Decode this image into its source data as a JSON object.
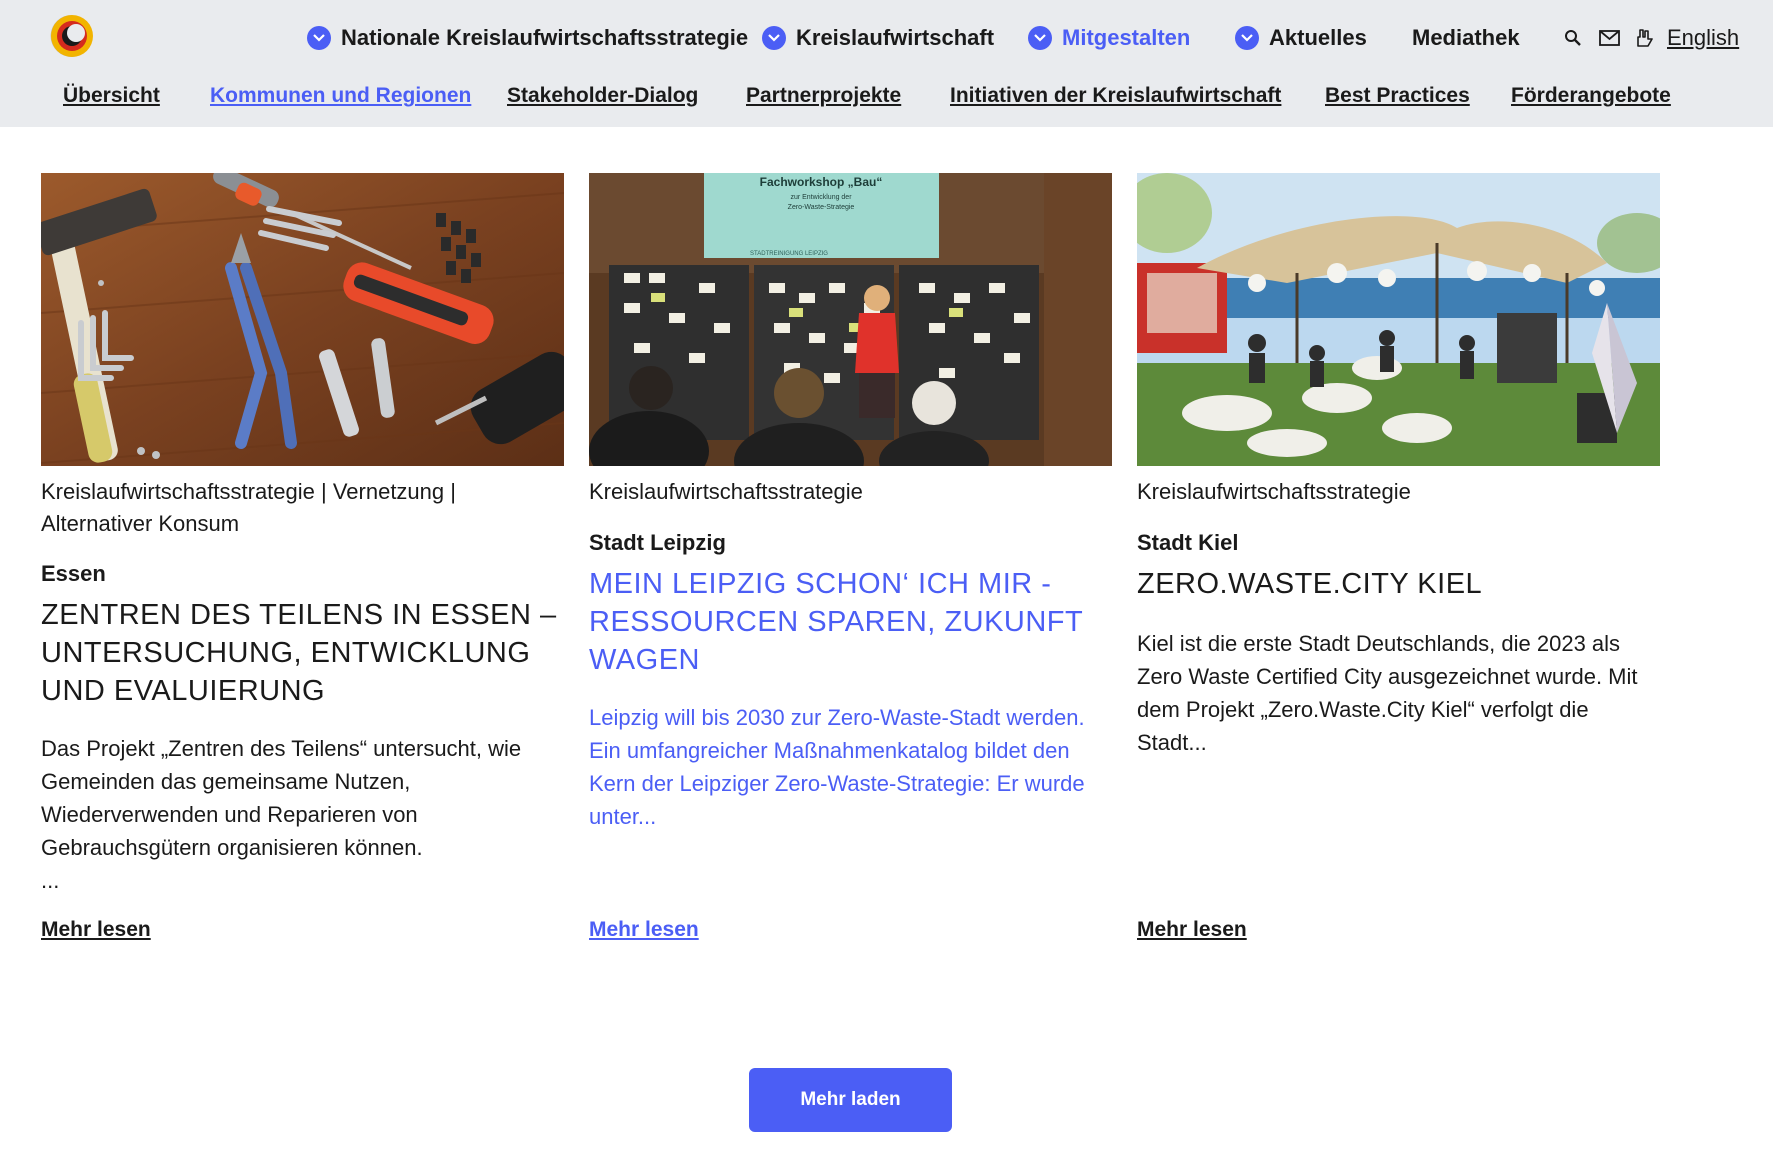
{
  "header": {
    "main_nav": [
      {
        "label": "Nationale Kreislaufwirtschaftsstrategie"
      },
      {
        "label": "Kreislaufwirtschaft"
      },
      {
        "label": "Mitgestalten"
      },
      {
        "label": "Aktuelles"
      },
      {
        "label": "Mediathek"
      }
    ],
    "language_label": "English",
    "sub_nav": [
      {
        "label": "Übersicht"
      },
      {
        "label": "Kommunen und Regionen"
      },
      {
        "label": "Stakeholder-Dialog"
      },
      {
        "label": "Partnerprojekte"
      },
      {
        "label": "Initiativen der Kreislaufwirtschaft"
      },
      {
        "label": "Best Practices"
      },
      {
        "label": "Förderangebote"
      }
    ]
  },
  "cards": [
    {
      "tags": "Kreislaufwirtschaftsstrategie | Vernetzung | Alternativer Konsum",
      "place": "Essen",
      "title": "Zentren des Teilens in Essen – Untersuchung, Entwicklung und Evaluierung",
      "text": "Das Projekt „Zentren des Teilens“ untersucht, wie Gemeinden das gemeinsame Nutzen, Wiederverwenden und Reparieren von Gebrauchsgütern organisieren können.",
      "ellipsis": "...",
      "more": "Mehr lesen"
    },
    {
      "tags": "Kreislaufwirtschaftsstrategie",
      "place": "Stadt Leipzig",
      "title": "Mein Leipzig schon‘ ich mir - Ressourcen sparen, Zukunft wagen",
      "text": "Leipzig will bis 2030 zur Zero-Waste-Stadt werden. Ein umfangreicher Maßnahmenkatalog bildet den Kern der Leipziger Zero-Waste-Strategie: Er wurde unter...",
      "more": "Mehr lesen",
      "image_sign_title": "Fachworkshop „Bau“",
      "image_sign_line1": "zur Entwicklung der",
      "image_sign_line2": "Zero-Waste-Strategie",
      "image_sign_footer": "STADTREINIGUNG LEIPZIG"
    },
    {
      "tags": "Kreislaufwirtschaftsstrategie",
      "place": "Stadt Kiel",
      "title": "Zero.Waste.City Kiel",
      "text": "Kiel ist die erste Stadt Deutschlands, die 2023 als Zero Waste Certified City ausgezeichnet wurde. Mit dem Projekt „Zero.Waste.City Kiel“ verfolgt die Stadt...",
      "more": "Mehr lesen"
    }
  ],
  "load_more_label": "Mehr laden",
  "icons": [
    "logo-icon",
    "chevron-down-icon",
    "search-icon",
    "mail-icon",
    "sign-language-icon"
  ],
  "colors": {
    "accent": "#4b5ef5",
    "header_bg": "#e9ebee",
    "text": "#1a1a1a"
  }
}
